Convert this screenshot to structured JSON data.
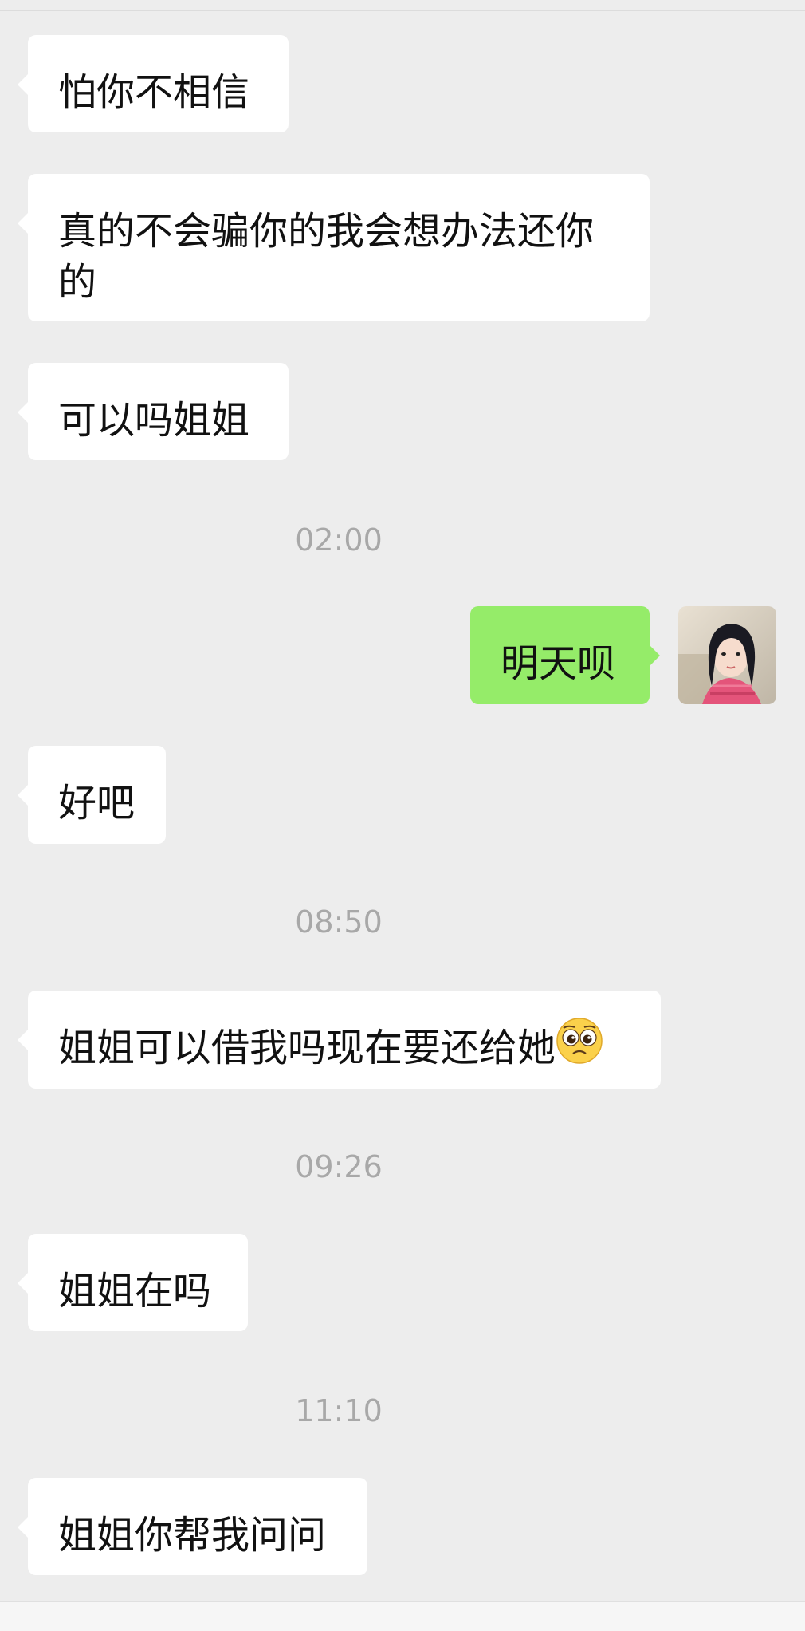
{
  "messages": [
    {
      "text": "怕你不相信"
    },
    {
      "text": "真的不会骗你的我会想办法还你的"
    },
    {
      "text": "可以吗姐姐"
    },
    {
      "time": "02:00"
    },
    {
      "text": "明天呗"
    },
    {
      "text": "好吧"
    },
    {
      "time": "08:50"
    },
    {
      "text": "姐姐可以借我吗现在要还给她"
    },
    {
      "time": "09:26"
    },
    {
      "text": "姐姐在吗"
    },
    {
      "time": "11:10"
    },
    {
      "text": "姐姐你帮我问问"
    }
  ],
  "emoji": {
    "name": "pleading-face-icon"
  },
  "colors": {
    "background": "#ededed",
    "incoming_bubble": "#ffffff",
    "outgoing_bubble": "#95ec69",
    "timestamp": "#a8a8a8"
  }
}
